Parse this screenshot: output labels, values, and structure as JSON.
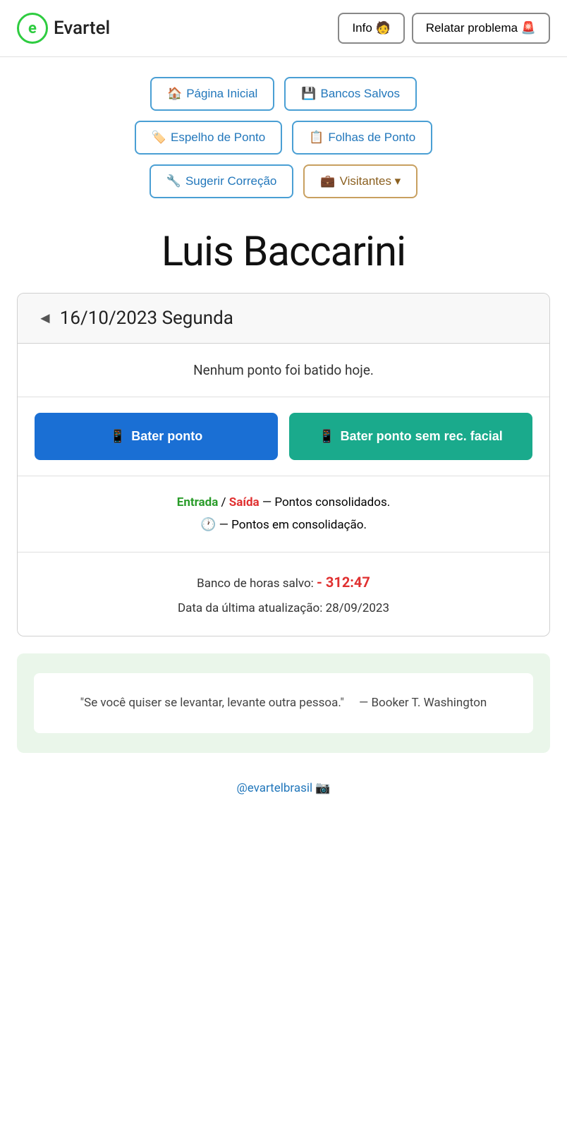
{
  "header": {
    "logo_letter": "e",
    "logo_name": "Evartel",
    "info_button": "Info 🧑",
    "report_button": "Relatar problema 🚨"
  },
  "nav": {
    "row1": [
      {
        "id": "pagina-inicial",
        "icon": "🏠",
        "label": "Página Inicial"
      },
      {
        "id": "bancos-salvos",
        "icon": "💾",
        "label": "Bancos Salvos"
      }
    ],
    "row2": [
      {
        "id": "espelho-de-ponto",
        "icon": "🏷️",
        "label": "Espelho de Ponto"
      },
      {
        "id": "folhas-de-ponto",
        "icon": "📋",
        "label": "Folhas de Ponto"
      }
    ],
    "row3": [
      {
        "id": "sugerir-correcao",
        "icon": "🔧",
        "label": "Sugerir Correção"
      },
      {
        "id": "visitantes",
        "icon": "💼",
        "label": "Visitantes ▾",
        "style": "brown"
      }
    ]
  },
  "user": {
    "name": "Luis Baccarini"
  },
  "date_card": {
    "arrow": "◄",
    "date": "16/10/2023 Segunda",
    "no_punch_message": "Nenhum ponto foi batido hoje.",
    "btn_punch": "Bater ponto",
    "btn_punch_icon": "📱",
    "btn_punch_no_facial": "Bater ponto sem rec. facial",
    "btn_punch_no_facial_icon": "📱",
    "legend_entrada": "Entrada",
    "legend_separator": " / ",
    "legend_saida": "Saída",
    "legend_consolidated": " — Pontos consolidados.",
    "legend_consolidating": " — Pontos em consolidação.",
    "bank_hours_label": "Banco de horas salvo: ",
    "bank_hours_value": "- 312:47",
    "last_update_label": "Data da última atualização: ",
    "last_update_date": "28/09/2023"
  },
  "quote": {
    "text": "\"Se você quiser se levantar, levante outra pessoa.\"",
    "author": "— Booker T. Washington"
  },
  "footer": {
    "instagram_handle": "@evartelbrasil",
    "instagram_icon": "📷"
  }
}
